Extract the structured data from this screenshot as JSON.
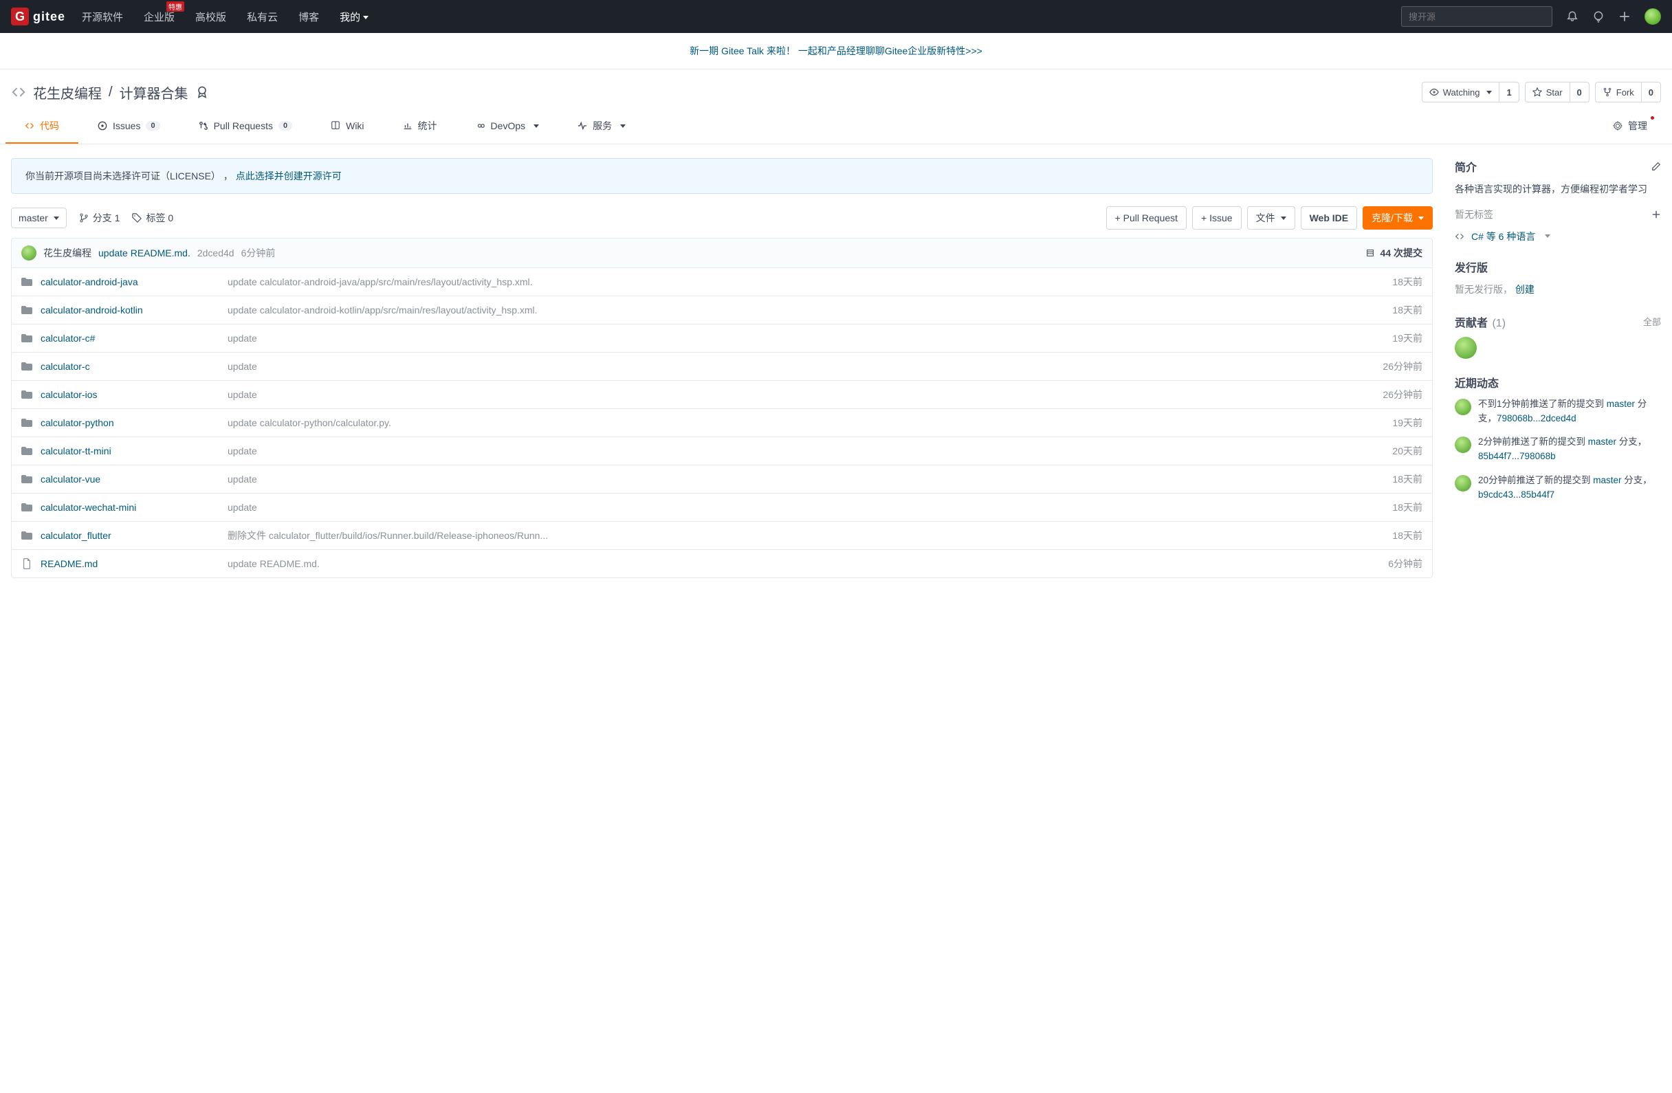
{
  "brand": "gitee",
  "navbar": {
    "items": [
      {
        "label": "开源软件"
      },
      {
        "label": "企业版",
        "badge": "特惠"
      },
      {
        "label": "高校版"
      },
      {
        "label": "私有云"
      },
      {
        "label": "博客"
      },
      {
        "label": "我的",
        "caret": true
      }
    ],
    "search_placeholder": "搜开源"
  },
  "banner": "新一期 Gitee Talk 来啦！ 一起和产品经理聊聊Gitee企业版新特性>>>",
  "repo": {
    "owner": "花生皮编程",
    "name": "计算器合集"
  },
  "actions": {
    "watch": {
      "label": "Watching",
      "count": "1"
    },
    "star": {
      "label": "Star",
      "count": "0"
    },
    "fork": {
      "label": "Fork",
      "count": "0"
    }
  },
  "tabs": {
    "code": "代码",
    "issues": {
      "label": "Issues",
      "count": "0"
    },
    "pr": {
      "label": "Pull Requests",
      "count": "0"
    },
    "wiki": "Wiki",
    "stats": "统计",
    "devops": "DevOps",
    "services": "服务",
    "manage": "管理"
  },
  "license_notice": {
    "text": "你当前开源项目尚未选择许可证（LICENSE） ， ",
    "link": "点此选择并创建开源许可"
  },
  "toolbar": {
    "branch": "master",
    "branches": "分支 1",
    "tags": "标签 0",
    "pr_btn": "+ Pull Request",
    "issue_btn": "+ Issue",
    "file_btn": "文件",
    "webide_btn": "Web IDE",
    "clone_btn": "克隆/下载"
  },
  "latest_commit": {
    "author": "花生皮编程",
    "msg": "update README.md.",
    "hash": "2dced4d",
    "time": "6分钟前",
    "total": "44 次提交"
  },
  "files": [
    {
      "type": "dir",
      "name": "calculator-android-java",
      "msg": "update calculator-android-java/app/src/main/res/layout/activity_hsp.xml.",
      "time": "18天前"
    },
    {
      "type": "dir",
      "name": "calculator-android-kotlin",
      "msg": "update calculator-android-kotlin/app/src/main/res/layout/activity_hsp.xml.",
      "time": "18天前"
    },
    {
      "type": "dir",
      "name": "calculator-c#",
      "msg": "update",
      "time": "19天前"
    },
    {
      "type": "dir",
      "name": "calculator-c",
      "msg": "update",
      "time": "26分钟前"
    },
    {
      "type": "dir",
      "name": "calculator-ios",
      "msg": "update",
      "time": "26分钟前"
    },
    {
      "type": "dir",
      "name": "calculator-python",
      "msg": "update calculator-python/calculator.py.",
      "time": "19天前"
    },
    {
      "type": "dir",
      "name": "calculator-tt-mini",
      "msg": "update",
      "time": "20天前"
    },
    {
      "type": "dir",
      "name": "calculator-vue",
      "msg": "update",
      "time": "18天前"
    },
    {
      "type": "dir",
      "name": "calculator-wechat-mini",
      "msg": "update",
      "time": "18天前"
    },
    {
      "type": "dir",
      "name": "calculator_flutter",
      "msg": "删除文件 calculator_flutter/build/ios/Runner.build/Release-iphoneos/Runn...",
      "time": "18天前"
    },
    {
      "type": "file",
      "name": "README.md",
      "msg": "update README.md.",
      "time": "6分钟前"
    }
  ],
  "sidebar": {
    "intro": {
      "title": "简介",
      "text": "各种语言实现的计算器，方便编程初学者学习",
      "no_labels": "暂无标签"
    },
    "lang": "C# 等 6 种语言",
    "releases": {
      "title": "发行版",
      "none": "暂无发行版，",
      "create": "创建"
    },
    "contributors": {
      "title": "贡献者",
      "count": "(1)",
      "all": "全部"
    },
    "recent": {
      "title": "近期动态"
    },
    "activities": [
      {
        "pre": "不到1分钟前推送了新的提交到 ",
        "branch": "master",
        "mid": " 分支，",
        "hash": "798068b...2dced4d"
      },
      {
        "pre": "2分钟前推送了新的提交到 ",
        "branch": "master",
        "mid": " 分支，",
        "hash": "85b44f7...798068b"
      },
      {
        "pre": "20分钟前推送了新的提交到 ",
        "branch": "master",
        "mid": " 分支，",
        "hash": "b9cdc43...85b44f7"
      }
    ]
  }
}
